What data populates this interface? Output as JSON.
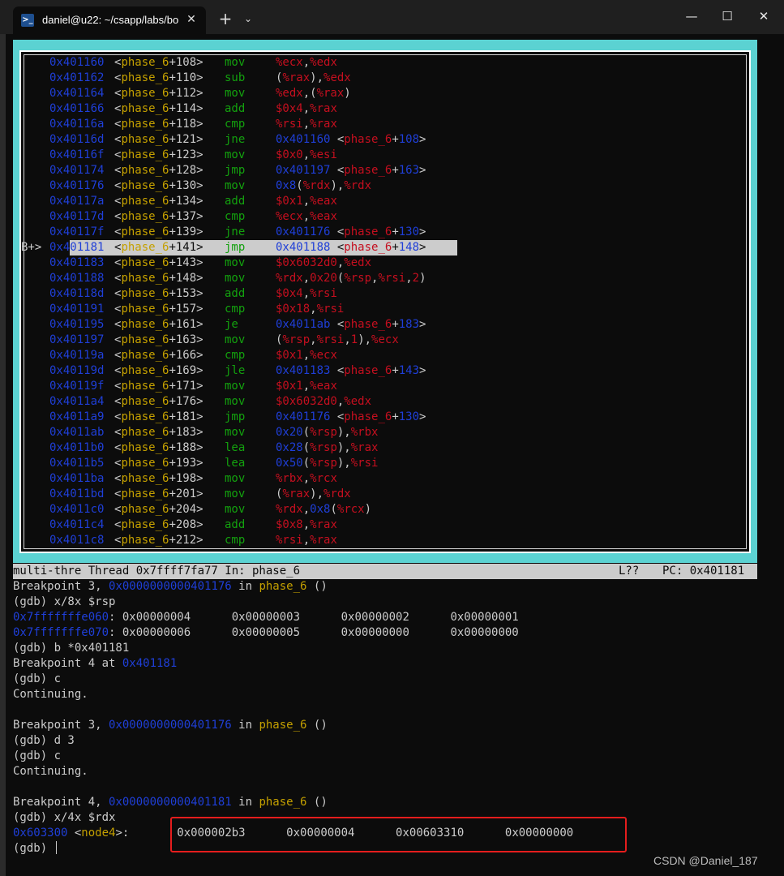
{
  "window": {
    "tab_title": "daniel@u22: ~/csapp/labs/bo",
    "tab_icon": "terminal-icon",
    "close_tab": "✕",
    "new_tab": "+",
    "tab_menu": "⌄",
    "minimize": "—",
    "maximize": "☐",
    "close": "✕"
  },
  "colors": {
    "tui_border": "#5bd2d2",
    "address": "#1f3fd8",
    "function": "#c4a000",
    "mnemonic": "#13a10e",
    "register": "#c50f1f",
    "highlight_bg": "#cccccc",
    "annotation_box": "#e51d1d"
  },
  "asm": [
    {
      "marker": "",
      "addr": "0x401160",
      "fn": "phase_6",
      "off": "+108",
      "mn": "mov",
      "ops": [
        [
          "r",
          "%ecx"
        ],
        [
          "t",
          ","
        ],
        [
          "r",
          "%edx"
        ]
      ]
    },
    {
      "marker": "",
      "addr": "0x401162",
      "fn": "phase_6",
      "off": "+110",
      "mn": "sub",
      "ops": [
        [
          "t",
          "("
        ],
        [
          "r",
          "%rax"
        ],
        [
          "t",
          "),"
        ],
        [
          "r",
          "%edx"
        ]
      ]
    },
    {
      "marker": "",
      "addr": "0x401164",
      "fn": "phase_6",
      "off": "+112",
      "mn": "mov",
      "ops": [
        [
          "r",
          "%edx"
        ],
        [
          "t",
          ",("
        ],
        [
          "r",
          "%rax"
        ],
        [
          "t",
          ")"
        ]
      ]
    },
    {
      "marker": "",
      "addr": "0x401166",
      "fn": "phase_6",
      "off": "+114",
      "mn": "add",
      "ops": [
        [
          "r",
          "$0x4"
        ],
        [
          "t",
          ","
        ],
        [
          "r",
          "%rax"
        ]
      ]
    },
    {
      "marker": "",
      "addr": "0x40116a",
      "fn": "phase_6",
      "off": "+118",
      "mn": "cmp",
      "ops": [
        [
          "r",
          "%rsi"
        ],
        [
          "t",
          ","
        ],
        [
          "r",
          "%rax"
        ]
      ]
    },
    {
      "marker": "",
      "addr": "0x40116d",
      "fn": "phase_6",
      "off": "+121",
      "mn": "jne",
      "ops": [
        [
          "a",
          "0x401160"
        ],
        [
          "t",
          " <"
        ],
        [
          "r",
          "phase_6"
        ],
        [
          "t",
          "+"
        ],
        [
          "a",
          "108"
        ],
        [
          "t",
          ">"
        ]
      ]
    },
    {
      "marker": "",
      "addr": "0x40116f",
      "fn": "phase_6",
      "off": "+123",
      "mn": "mov",
      "ops": [
        [
          "r",
          "$0x0"
        ],
        [
          "t",
          ","
        ],
        [
          "r",
          "%esi"
        ]
      ]
    },
    {
      "marker": "",
      "addr": "0x401174",
      "fn": "phase_6",
      "off": "+128",
      "mn": "jmp",
      "ops": [
        [
          "a",
          "0x401197"
        ],
        [
          "t",
          " <"
        ],
        [
          "r",
          "phase_6"
        ],
        [
          "t",
          "+"
        ],
        [
          "a",
          "163"
        ],
        [
          "t",
          ">"
        ]
      ]
    },
    {
      "marker": "",
      "addr": "0x401176",
      "fn": "phase_6",
      "off": "+130",
      "mn": "mov",
      "ops": [
        [
          "a",
          "0x8"
        ],
        [
          "t",
          "("
        ],
        [
          "r",
          "%rdx"
        ],
        [
          "t",
          "),"
        ],
        [
          "r",
          "%rdx"
        ]
      ]
    },
    {
      "marker": "",
      "addr": "0x40117a",
      "fn": "phase_6",
      "off": "+134",
      "mn": "add",
      "ops": [
        [
          "r",
          "$0x1"
        ],
        [
          "t",
          ","
        ],
        [
          "r",
          "%eax"
        ]
      ]
    },
    {
      "marker": "",
      "addr": "0x40117d",
      "fn": "phase_6",
      "off": "+137",
      "mn": "cmp",
      "ops": [
        [
          "r",
          "%ecx"
        ],
        [
          "t",
          ","
        ],
        [
          "r",
          "%eax"
        ]
      ]
    },
    {
      "marker": "",
      "addr": "0x40117f",
      "fn": "phase_6",
      "off": "+139",
      "mn": "jne",
      "ops": [
        [
          "a",
          "0x401176"
        ],
        [
          "t",
          " <"
        ],
        [
          "r",
          "phase_6"
        ],
        [
          "t",
          "+"
        ],
        [
          "a",
          "130"
        ],
        [
          "t",
          ">"
        ]
      ]
    },
    {
      "marker": "B+>",
      "addr": "0x401181",
      "fn": "phase_6",
      "off": "+141",
      "mn": "jmp",
      "highlight": true,
      "ops": [
        [
          "a",
          "0x401188"
        ],
        [
          "t",
          " <"
        ],
        [
          "r",
          "phase_6"
        ],
        [
          "t",
          "+"
        ],
        [
          "a",
          "148"
        ],
        [
          "t",
          ">"
        ]
      ]
    },
    {
      "marker": "",
      "addr": "0x401183",
      "fn": "phase_6",
      "off": "+143",
      "mn": "mov",
      "ops": [
        [
          "r",
          "$0x6032d0"
        ],
        [
          "t",
          ","
        ],
        [
          "r",
          "%edx"
        ]
      ]
    },
    {
      "marker": "",
      "addr": "0x401188",
      "fn": "phase_6",
      "off": "+148",
      "mn": "mov",
      "ops": [
        [
          "r",
          "%rdx"
        ],
        [
          "t",
          ","
        ],
        [
          "r",
          "0x20"
        ],
        [
          "t",
          "("
        ],
        [
          "r",
          "%rsp"
        ],
        [
          "t",
          ","
        ],
        [
          "r",
          "%rsi"
        ],
        [
          "t",
          ","
        ],
        [
          "r",
          "2"
        ],
        [
          "t",
          ")"
        ]
      ]
    },
    {
      "marker": "",
      "addr": "0x40118d",
      "fn": "phase_6",
      "off": "+153",
      "mn": "add",
      "ops": [
        [
          "r",
          "$0x4"
        ],
        [
          "t",
          ","
        ],
        [
          "r",
          "%rsi"
        ]
      ]
    },
    {
      "marker": "",
      "addr": "0x401191",
      "fn": "phase_6",
      "off": "+157",
      "mn": "cmp",
      "ops": [
        [
          "r",
          "$0x18"
        ],
        [
          "t",
          ","
        ],
        [
          "r",
          "%rsi"
        ]
      ]
    },
    {
      "marker": "",
      "addr": "0x401195",
      "fn": "phase_6",
      "off": "+161",
      "mn": "je",
      "ops": [
        [
          "a",
          "0x4011ab"
        ],
        [
          "t",
          " <"
        ],
        [
          "r",
          "phase_6"
        ],
        [
          "t",
          "+"
        ],
        [
          "a",
          "183"
        ],
        [
          "t",
          ">"
        ]
      ]
    },
    {
      "marker": "",
      "addr": "0x401197",
      "fn": "phase_6",
      "off": "+163",
      "mn": "mov",
      "ops": [
        [
          "t",
          "("
        ],
        [
          "r",
          "%rsp"
        ],
        [
          "t",
          ","
        ],
        [
          "r",
          "%rsi"
        ],
        [
          "t",
          ","
        ],
        [
          "r",
          "1"
        ],
        [
          "t",
          "),"
        ],
        [
          "r",
          "%ecx"
        ]
      ]
    },
    {
      "marker": "",
      "addr": "0x40119a",
      "fn": "phase_6",
      "off": "+166",
      "mn": "cmp",
      "ops": [
        [
          "r",
          "$0x1"
        ],
        [
          "t",
          ","
        ],
        [
          "r",
          "%ecx"
        ]
      ]
    },
    {
      "marker": "",
      "addr": "0x40119d",
      "fn": "phase_6",
      "off": "+169",
      "mn": "jle",
      "ops": [
        [
          "a",
          "0x401183"
        ],
        [
          "t",
          " <"
        ],
        [
          "r",
          "phase_6"
        ],
        [
          "t",
          "+"
        ],
        [
          "a",
          "143"
        ],
        [
          "t",
          ">"
        ]
      ]
    },
    {
      "marker": "",
      "addr": "0x40119f",
      "fn": "phase_6",
      "off": "+171",
      "mn": "mov",
      "ops": [
        [
          "r",
          "$0x1"
        ],
        [
          "t",
          ","
        ],
        [
          "r",
          "%eax"
        ]
      ]
    },
    {
      "marker": "",
      "addr": "0x4011a4",
      "fn": "phase_6",
      "off": "+176",
      "mn": "mov",
      "ops": [
        [
          "r",
          "$0x6032d0"
        ],
        [
          "t",
          ","
        ],
        [
          "r",
          "%edx"
        ]
      ]
    },
    {
      "marker": "",
      "addr": "0x4011a9",
      "fn": "phase_6",
      "off": "+181",
      "mn": "jmp",
      "ops": [
        [
          "a",
          "0x401176"
        ],
        [
          "t",
          " <"
        ],
        [
          "r",
          "phase_6"
        ],
        [
          "t",
          "+"
        ],
        [
          "a",
          "130"
        ],
        [
          "t",
          ">"
        ]
      ]
    },
    {
      "marker": "",
      "addr": "0x4011ab",
      "fn": "phase_6",
      "off": "+183",
      "mn": "mov",
      "ops": [
        [
          "a",
          "0x20"
        ],
        [
          "t",
          "("
        ],
        [
          "r",
          "%rsp"
        ],
        [
          "t",
          "),"
        ],
        [
          "r",
          "%rbx"
        ]
      ]
    },
    {
      "marker": "",
      "addr": "0x4011b0",
      "fn": "phase_6",
      "off": "+188",
      "mn": "lea",
      "ops": [
        [
          "a",
          "0x28"
        ],
        [
          "t",
          "("
        ],
        [
          "r",
          "%rsp"
        ],
        [
          "t",
          "),"
        ],
        [
          "r",
          "%rax"
        ]
      ]
    },
    {
      "marker": "",
      "addr": "0x4011b5",
      "fn": "phase_6",
      "off": "+193",
      "mn": "lea",
      "ops": [
        [
          "a",
          "0x50"
        ],
        [
          "t",
          "("
        ],
        [
          "r",
          "%rsp"
        ],
        [
          "t",
          "),"
        ],
        [
          "r",
          "%rsi"
        ]
      ]
    },
    {
      "marker": "",
      "addr": "0x4011ba",
      "fn": "phase_6",
      "off": "+198",
      "mn": "mov",
      "ops": [
        [
          "r",
          "%rbx"
        ],
        [
          "t",
          ","
        ],
        [
          "r",
          "%rcx"
        ]
      ]
    },
    {
      "marker": "",
      "addr": "0x4011bd",
      "fn": "phase_6",
      "off": "+201",
      "mn": "mov",
      "ops": [
        [
          "t",
          "("
        ],
        [
          "r",
          "%rax"
        ],
        [
          "t",
          "),"
        ],
        [
          "r",
          "%rdx"
        ]
      ]
    },
    {
      "marker": "",
      "addr": "0x4011c0",
      "fn": "phase_6",
      "off": "+204",
      "mn": "mov",
      "ops": [
        [
          "r",
          "%rdx"
        ],
        [
          "t",
          ","
        ],
        [
          "a",
          "0x8"
        ],
        [
          "t",
          "("
        ],
        [
          "r",
          "%rcx"
        ],
        [
          "t",
          ")"
        ]
      ]
    },
    {
      "marker": "",
      "addr": "0x4011c4",
      "fn": "phase_6",
      "off": "+208",
      "mn": "add",
      "ops": [
        [
          "r",
          "$0x8"
        ],
        [
          "t",
          ","
        ],
        [
          "r",
          "%rax"
        ]
      ]
    },
    {
      "marker": "",
      "addr": "0x4011c8",
      "fn": "phase_6",
      "off": "+212",
      "mn": "cmp",
      "ops": [
        [
          "r",
          "%rsi"
        ],
        [
          "t",
          ","
        ],
        [
          "r",
          "%rax"
        ]
      ]
    }
  ],
  "status": {
    "left": "multi-thre Thread 0x7ffff7fa77 In: phase_6",
    "line": "L??",
    "pc": "PC: 0x401181"
  },
  "console": [
    [
      [
        "t",
        "Breakpoint 3, "
      ],
      [
        "a",
        "0x0000000000401176"
      ],
      [
        "t",
        " in "
      ],
      [
        "f",
        "phase_6"
      ],
      [
        "t",
        " ()"
      ]
    ],
    [
      [
        "t",
        "(gdb) x/8x $rsp"
      ]
    ],
    [
      [
        "a",
        "0x7fffffffe060"
      ],
      [
        "t",
        ": 0x00000004      0x00000003      0x00000002      0x00000001"
      ]
    ],
    [
      [
        "a",
        "0x7fffffffe070"
      ],
      [
        "t",
        ": 0x00000006      0x00000005      0x00000000      0x00000000"
      ]
    ],
    [
      [
        "t",
        "(gdb) b *0x401181"
      ]
    ],
    [
      [
        "t",
        "Breakpoint 4 at "
      ],
      [
        "a",
        "0x401181"
      ]
    ],
    [
      [
        "t",
        "(gdb) c"
      ]
    ],
    [
      [
        "t",
        "Continuing."
      ]
    ],
    [
      [
        "t",
        ""
      ]
    ],
    [
      [
        "t",
        "Breakpoint 3, "
      ],
      [
        "a",
        "0x0000000000401176"
      ],
      [
        "t",
        " in "
      ],
      [
        "f",
        "phase_6"
      ],
      [
        "t",
        " ()"
      ]
    ],
    [
      [
        "t",
        "(gdb) d 3"
      ]
    ],
    [
      [
        "t",
        "(gdb) c"
      ]
    ],
    [
      [
        "t",
        "Continuing."
      ]
    ],
    [
      [
        "t",
        ""
      ]
    ],
    [
      [
        "t",
        "Breakpoint 4, "
      ],
      [
        "a",
        "0x0000000000401181"
      ],
      [
        "t",
        " in "
      ],
      [
        "f",
        "phase_6"
      ],
      [
        "t",
        " ()"
      ]
    ],
    [
      [
        "t",
        "(gdb) x/4x $rdx"
      ]
    ],
    [
      [
        "a",
        "0x603300"
      ],
      [
        "t",
        " <"
      ],
      [
        "f",
        "node4"
      ],
      [
        "t",
        ">:       0x000002b3      0x00000004      0x00603310      0x00000000"
      ]
    ],
    [
      [
        "t",
        "(gdb) "
      ],
      [
        "cursor",
        ""
      ]
    ]
  ],
  "watermark": "CSDN @Daniel_187"
}
